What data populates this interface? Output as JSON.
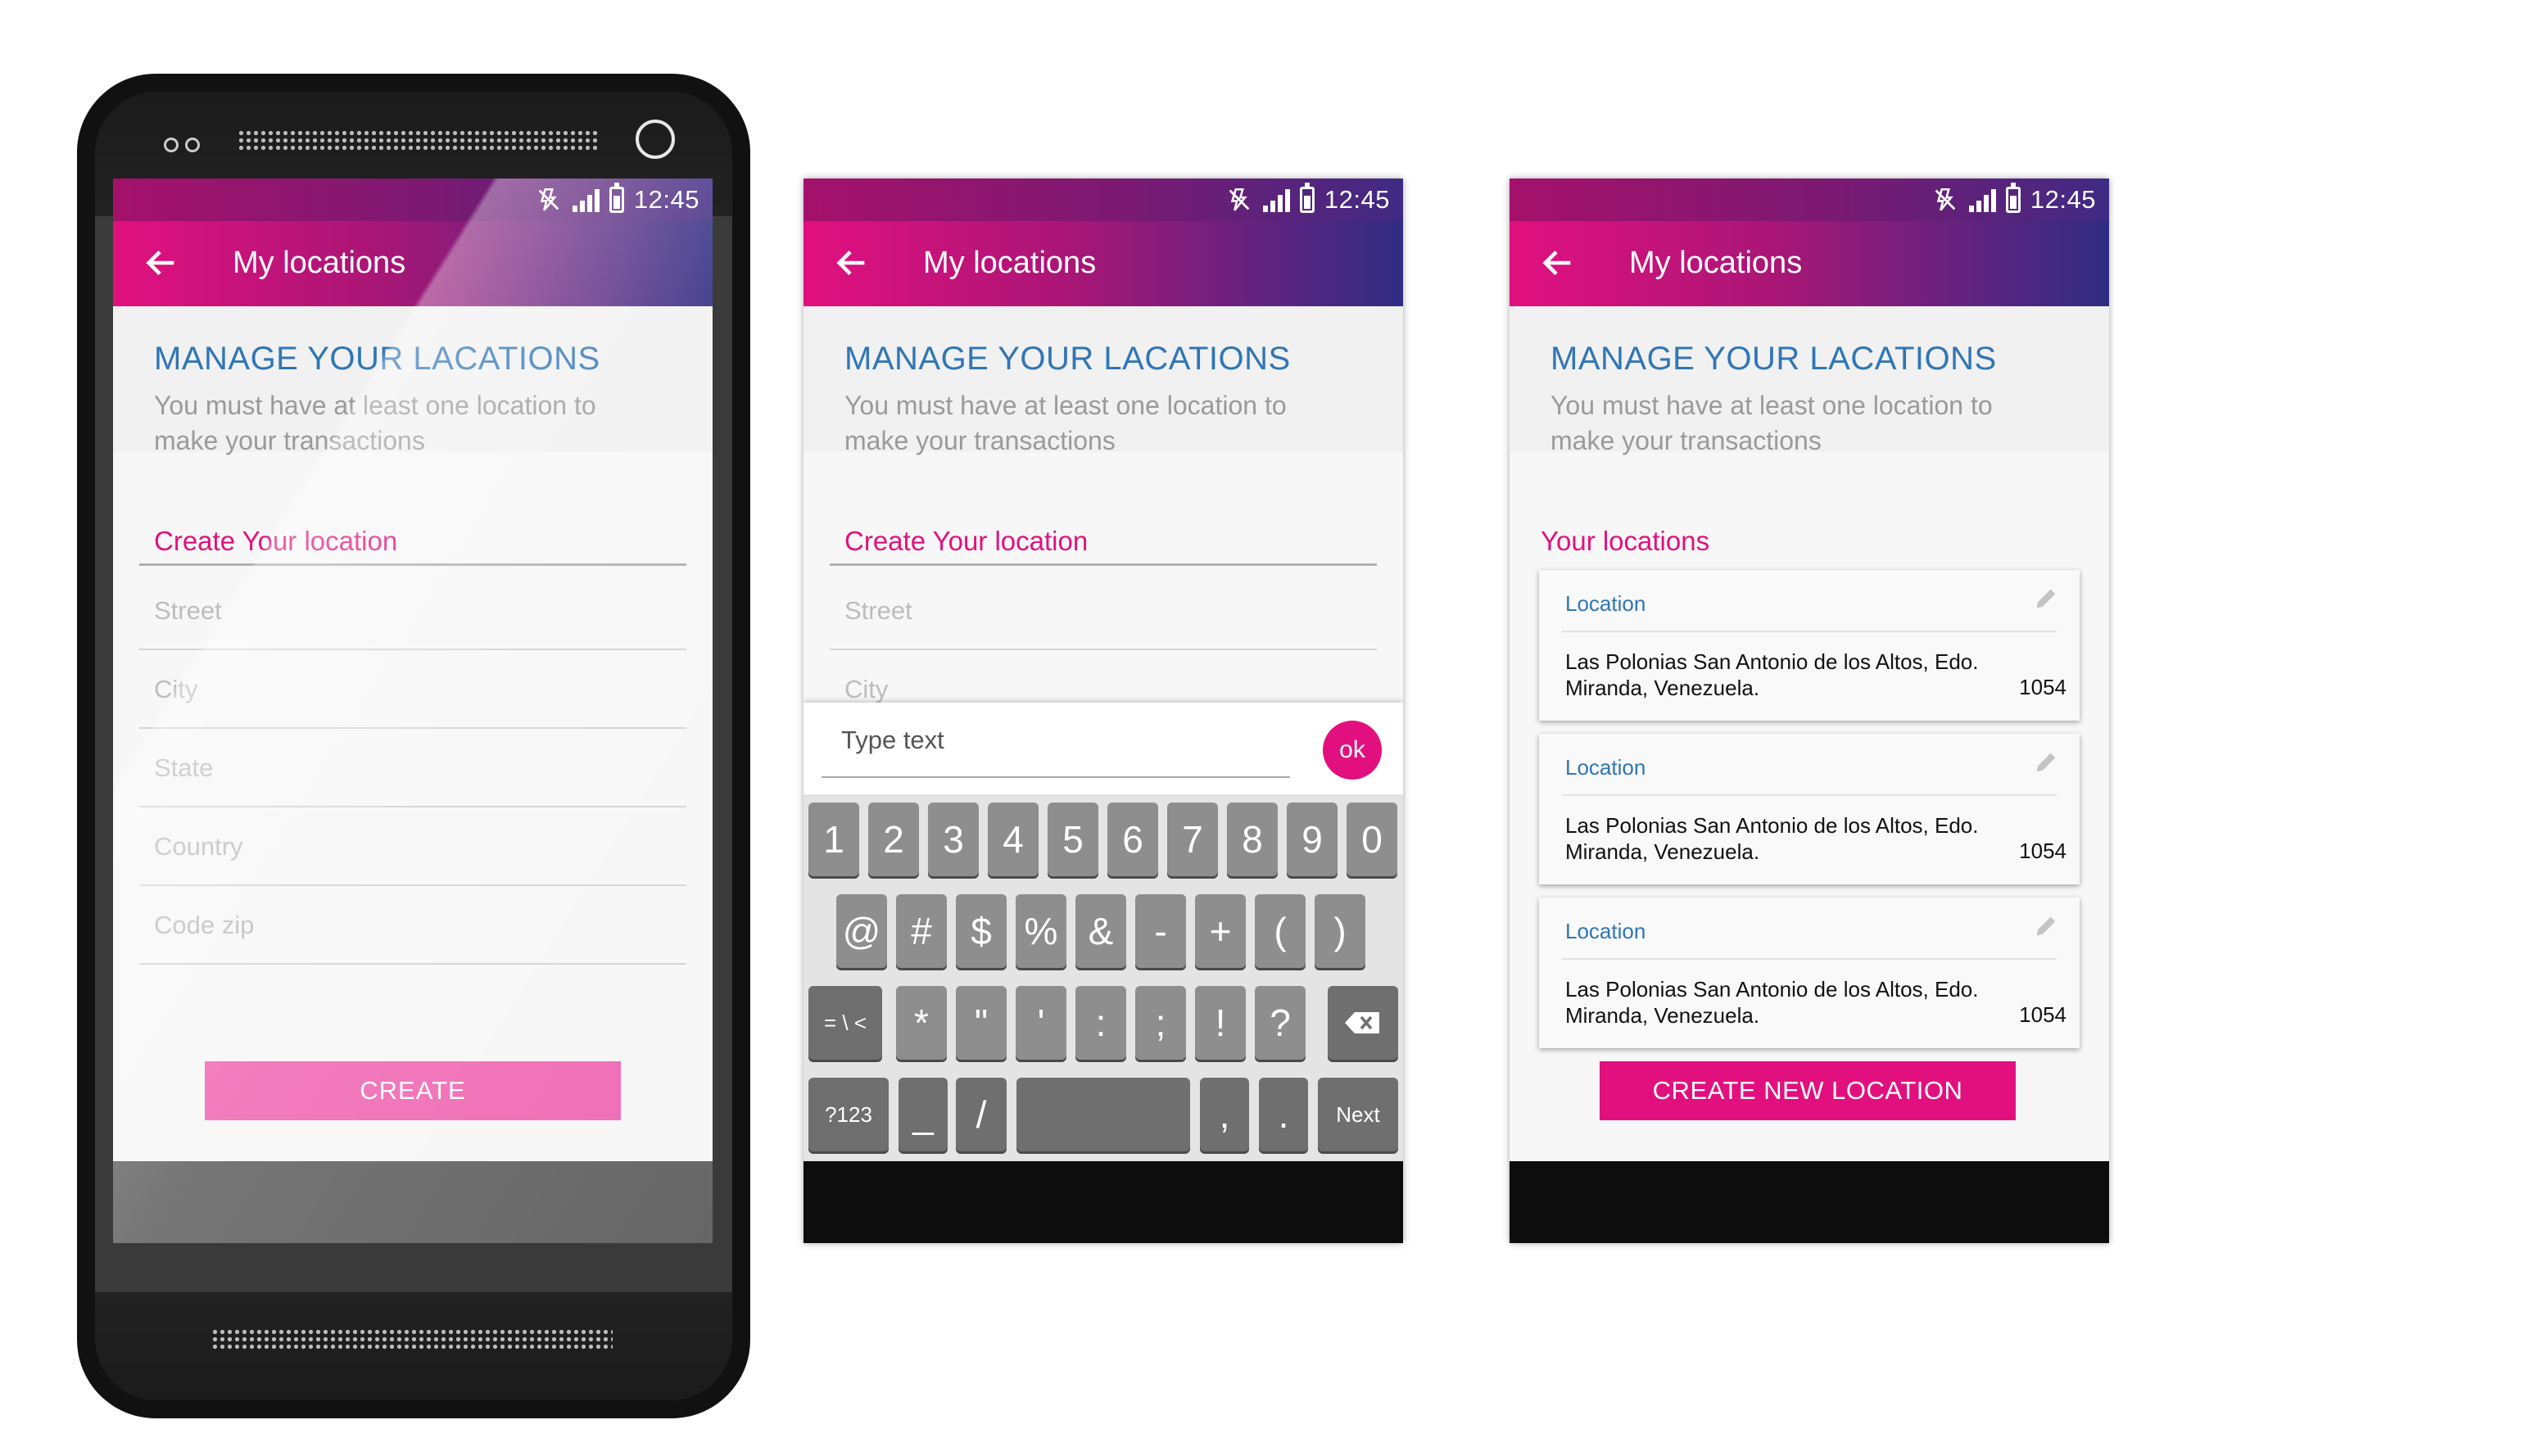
{
  "statusbar": {
    "time": "12:45"
  },
  "appbar": {
    "title": "My locations"
  },
  "header": {
    "title": "MANAGE YOUR LACATIONS",
    "subtitle": "You must have at least one location to make your transactions"
  },
  "form": {
    "heading": "Create Your location",
    "fields": [
      "Street",
      "City",
      "State",
      "Country",
      "Code zip"
    ],
    "create_label": "CREATE"
  },
  "keyboard_screen": {
    "fields": [
      "Street",
      "City"
    ],
    "input_placeholder": "Type text",
    "ok_label": "ok",
    "rows": [
      [
        "1",
        "2",
        "3",
        "4",
        "5",
        "6",
        "7",
        "8",
        "9",
        "0"
      ],
      [
        "@",
        "#",
        "$",
        "%",
        "&",
        "-",
        "+",
        "(",
        ")"
      ],
      [
        "= \\ <",
        "*",
        "\"",
        "'",
        ":",
        ";",
        "!",
        "?"
      ],
      [
        "?123",
        "_",
        "/",
        "",
        ",",
        ".",
        "Next"
      ]
    ]
  },
  "list_screen": {
    "heading": "Your locations",
    "locations": [
      {
        "label": "Location",
        "address": "Las Polonias San Antonio de los Altos, Edo. Miranda, Venezuela.",
        "zip": "1054"
      },
      {
        "label": "Location",
        "address": "Las Polonias San Antonio de los Altos, Edo. Miranda, Venezuela.",
        "zip": "1054"
      },
      {
        "label": "Location",
        "address": "Las Polonias San Antonio de los Altos, Edo. Miranda, Venezuela.",
        "zip": "1054"
      }
    ],
    "create_new_label": "CREATE NEW LOCATION"
  },
  "colors": {
    "accent": "#e2107f",
    "title_blue": "#3076b5",
    "create_light": "#f06cb5"
  }
}
